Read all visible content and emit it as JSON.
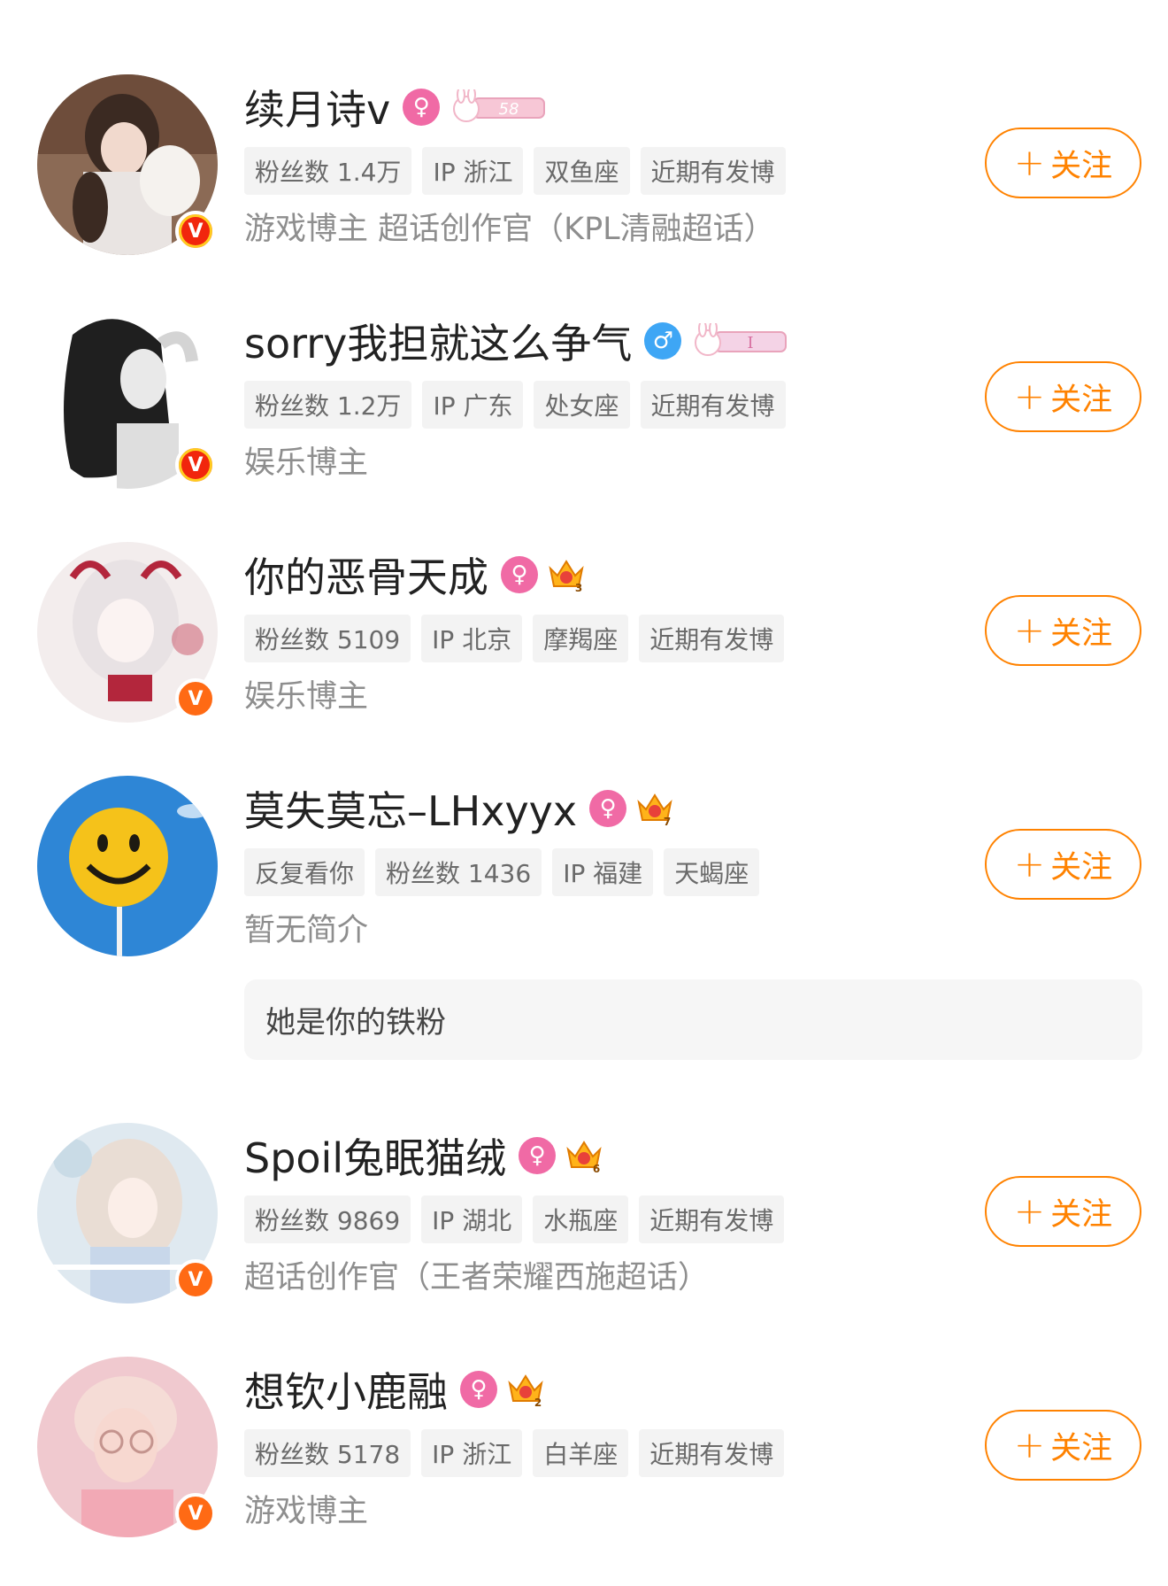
{
  "users": [
    {
      "name": "续月诗v",
      "gender": "♀",
      "level_badge": "bunny-level-icon",
      "level_text": "58",
      "tags": [
        "粉丝数 1.4万",
        "IP 浙江",
        "双鱼座",
        "近期有发博"
      ],
      "desc": "游戏博主 超话创作官（KPL清融超话）",
      "follow_label": "关注",
      "verify": "gold"
    },
    {
      "name": "sorry我担就这么争气",
      "gender": "♂",
      "level_badge": "bunny-level-icon",
      "level_text": "I",
      "tags": [
        "粉丝数 1.2万",
        "IP 广东",
        "处女座",
        "近期有发博"
      ],
      "desc": "娱乐博主",
      "follow_label": "关注",
      "verify": "gold"
    },
    {
      "name": "你的恶骨天成",
      "gender": "♀",
      "level_badge": "crown-level-icon",
      "level_text": "3",
      "tags": [
        "粉丝数 5109",
        "IP 北京",
        "摩羯座",
        "近期有发博"
      ],
      "desc": "娱乐博主",
      "follow_label": "关注",
      "verify": "orange"
    },
    {
      "name": "莫失莫忘–LHxyyx",
      "gender": "♀",
      "level_badge": "crown-level-icon",
      "level_text": "7",
      "tags": [
        "反复看你",
        "粉丝数 1436",
        "IP 福建",
        "天蝎座"
      ],
      "desc": "暂无简介",
      "follow_label": "关注",
      "verify": "none"
    },
    {
      "name": "Spoil兔眠猫绒",
      "gender": "♀",
      "level_badge": "crown-level-icon",
      "level_text": "6",
      "tags": [
        "粉丝数 9869",
        "IP 湖北",
        "水瓶座",
        "近期有发博"
      ],
      "desc": "超话创作官（王者荣耀西施超话）",
      "follow_label": "关注",
      "verify": "orange"
    },
    {
      "name": "想钦小鹿融",
      "gender": "♀",
      "level_badge": "crown-level-icon",
      "level_text": "2",
      "tags": [
        "粉丝数 5178",
        "IP 浙江",
        "白羊座",
        "近期有发博"
      ],
      "desc": "游戏博主",
      "follow_label": "关注",
      "verify": "orange"
    }
  ],
  "fan_note": "她是你的铁粉",
  "verify_letter": "V",
  "follow_plus": "+",
  "colors": {
    "accent": "#ff8200",
    "female": "#f06aa5",
    "male": "#3ea6f5",
    "tag_bg": "#f3f3f3"
  }
}
